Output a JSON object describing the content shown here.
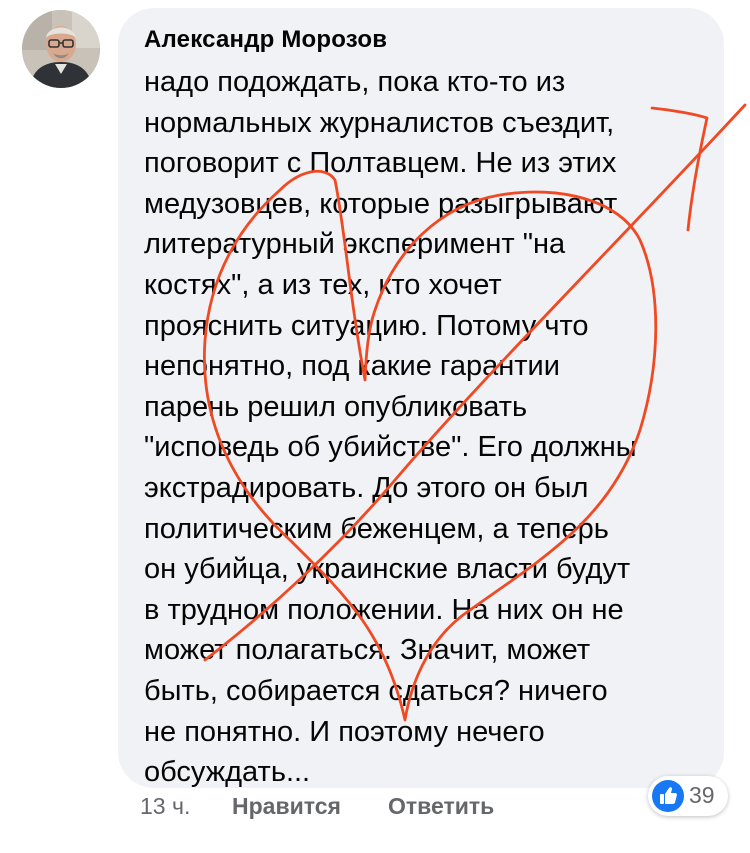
{
  "comment": {
    "author": "Александр Морозов",
    "text_lines": [
      "надо подождать, пока кто-то из",
      "нормальных журналистов съездит,",
      "поговорит с Полтавцем. Не из этих",
      "медузовцев, которые разыгрывают",
      "литературный эксперимент \"на",
      "костях\", а из тех, кто хочет",
      "прояснить ситуацию. Потому что",
      "непонятно, под какие гарантии",
      "парень решил опубликовать",
      "\"исповедь об убийстве\". Его должны",
      "экстрадировать. До этого он был",
      "политическим беженцем, а теперь",
      "он убийца, украинские власти будут",
      "в трудном положении. На них он не",
      "может полагаться. Значит, может",
      "быть, собирается сдаться? ничего",
      "не понятно. И поэтому нечего",
      "обсуждать..."
    ]
  },
  "actions": {
    "time": "13 ч.",
    "like_label": "Нравится",
    "reply_label": "Ответить"
  },
  "reactions": {
    "icon": "thumbs-up-icon",
    "count": "39"
  },
  "colors": {
    "bubble": "#f0f2f5",
    "text": "#050505",
    "meta": "#65676b",
    "like_blue": "#1877f2",
    "scribble": "#f04a24"
  }
}
